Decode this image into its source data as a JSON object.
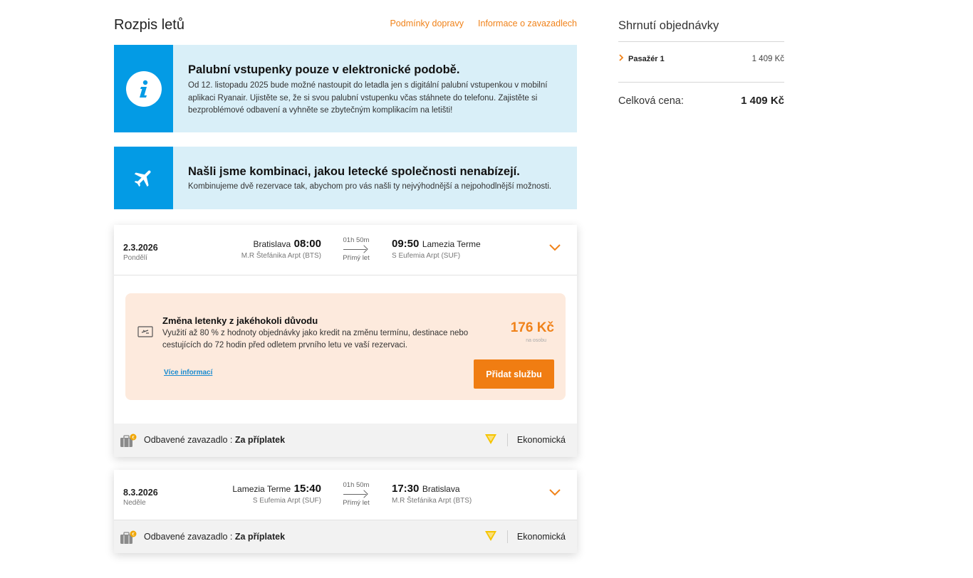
{
  "header": {
    "title": "Rozpis letů",
    "link_conditions": "Podmínky dopravy",
    "link_baggage": "Informace o zavazadlech"
  },
  "banner_boarding": {
    "icon": "info-icon",
    "title": "Palubní vstupenky pouze v elektronické podobě.",
    "text": "Od 12. listopadu 2025 bude možné nastoupit do letadla jen s digitální palubní vstupenkou v mobilní aplikaci Ryanair. Ujistěte se, že si svou palubní vstupenku včas stáhnete do telefonu. Zajistěte si bezproblémové odbavení a vyhněte se zbytečným komplikacím na letišti!"
  },
  "banner_combination": {
    "icon": "airplane-icon",
    "title": "Našli jsme kombinaci, jakou letecké společnosti nenabízejí.",
    "text": "Kombinujeme dvě rezervace tak, abychom pro vás našli ty nejvýhodnější a nejpohodlnější možnosti."
  },
  "flights": [
    {
      "date": "2.3.2026",
      "day": "Pondělí",
      "dep_city": "Bratislava",
      "dep_time": "08:00",
      "dep_airport": "M.R Štefánika Arpt (BTS)",
      "duration": "01h 50m",
      "type": "Přímý let",
      "arr_time": "09:50",
      "arr_city": "Lamezia Terme",
      "arr_airport": "S Eufemia Arpt (SUF)",
      "baggage_label": "Odbavené zavazadlo : ",
      "baggage_value": "Za příplatek",
      "travel_class": "Ekonomická"
    },
    {
      "date": "8.3.2026",
      "day": "Neděle",
      "dep_city": "Lamezia Terme",
      "dep_time": "15:40",
      "dep_airport": "S Eufemia Arpt (SUF)",
      "duration": "01h 50m",
      "type": "Přímý let",
      "arr_time": "17:30",
      "arr_city": "Bratislava",
      "arr_airport": "M.R Štefánika Arpt (BTS)",
      "baggage_label": "Odbavené zavazadlo : ",
      "baggage_value": "Za příplatek",
      "travel_class": "Ekonomická"
    }
  ],
  "offer": {
    "title": "Změna letenky z jakéhokoli důvodu",
    "text": "Využití až 80 % z hodnoty objednávky jako kredit na změnu termínu, destinace nebo cestujících do 72 hodin před odletem prvního letu ve vaší rezervaci.",
    "more_link": "Více informací",
    "price": "176 Kč",
    "per_person": "na osobu",
    "button": "Přidat službu"
  },
  "summary": {
    "title": "Shrnutí objednávky",
    "passenger_label": "Pasažér 1",
    "passenger_price": "1 409 Kč",
    "total_label": "Celková cena:",
    "total_price": "1 409 Kč"
  },
  "colors": {
    "accent": "#f08219",
    "info_blue": "#039be5",
    "banner_bg": "#d9eff8",
    "offer_bg": "#fdeadd",
    "link_blue": "#1a8bd0"
  }
}
